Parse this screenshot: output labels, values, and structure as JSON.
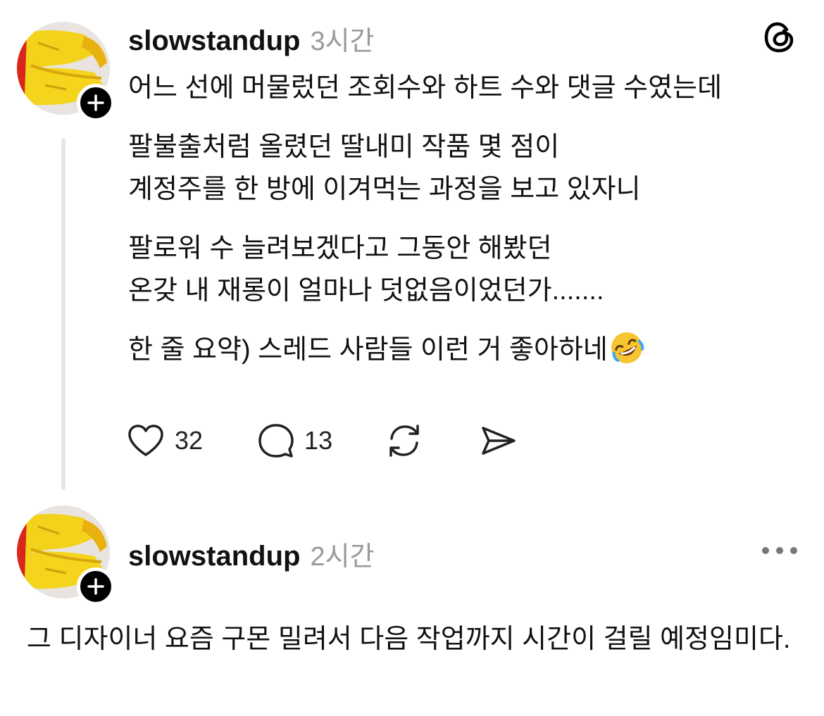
{
  "post1": {
    "username": "slowstandup",
    "time": "3시간",
    "paragraphs": [
      [
        "어느 선에 머물렀던 조회수와 하트 수와 댓글 수였는데"
      ],
      [
        "팔불출처럼 올렸던 딸내미 작품 몇 점이",
        "계정주를 한 방에 이겨먹는 과정을 보고 있자니"
      ],
      [
        "팔로워 수 늘려보겠다고 그동안 해봤던",
        "온갖 내 재롱이 얼마나 덧없음이었던가......."
      ],
      [
        "한 줄 요약) 스레드 사람들 이런 거 좋아하네"
      ]
    ],
    "emoji": "rolling-on-floor-laughing-emoji",
    "likes": "32",
    "comments": "13"
  },
  "post2": {
    "username": "slowstandup",
    "time": "2시간",
    "body": "그 디자이너 요즘 구몬 밀려서 다음 작업까지 시간이 걸릴 예정임미다."
  },
  "icons": {
    "threads_logo": "threads-logo-icon",
    "more": "more-icon",
    "heart": "heart-icon",
    "comment": "comment-icon",
    "repost": "repost-icon",
    "share": "share-icon",
    "follow": "plus-icon"
  }
}
